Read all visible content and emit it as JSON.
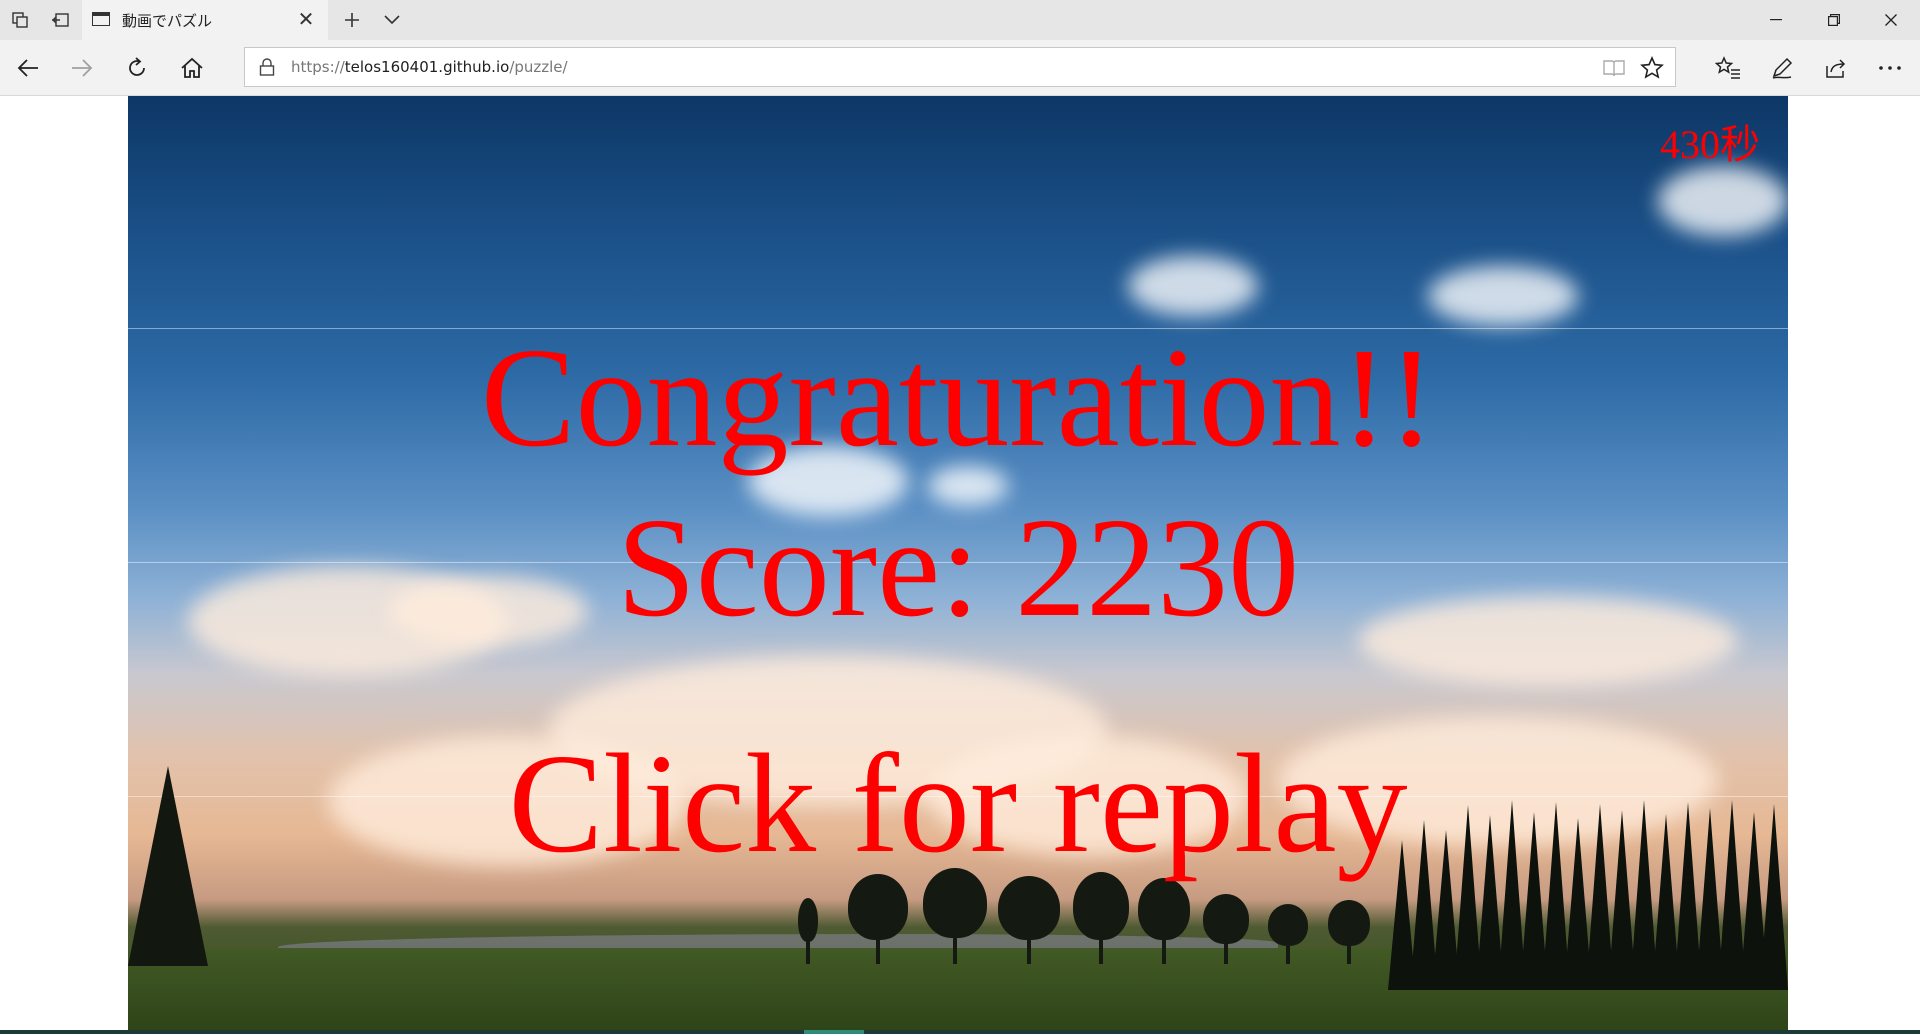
{
  "browser": {
    "tab": {
      "title": "動画でパズル"
    },
    "address": {
      "url_prefix": "https://",
      "url_host": "telos160401.github.io",
      "url_path": "/puzzle/"
    }
  },
  "icons": {
    "tab_actions": "tab-actions-icon",
    "set_aside": "set-aside-tabs-icon",
    "new_tab": "plus-icon",
    "tab_list": "chevron-down-icon",
    "minimize": "minimize-icon",
    "restore": "restore-icon",
    "close": "close-icon",
    "back": "arrow-left-icon",
    "forward": "arrow-right-icon",
    "refresh": "refresh-icon",
    "home": "home-icon",
    "lock": "lock-icon",
    "reading_view": "book-icon",
    "favorite": "star-icon",
    "favorites_hub": "star-list-icon",
    "notes": "pen-icon",
    "share": "share-icon",
    "more": "ellipsis-icon"
  },
  "game": {
    "timer": "430秒",
    "congrats": "Congraturation!!",
    "score": "Score: 2230",
    "replay": "Click for replay"
  },
  "colors": {
    "message": "#ff0000",
    "titlebar": "#e6e6e6",
    "navbar": "#f2f2f2"
  }
}
